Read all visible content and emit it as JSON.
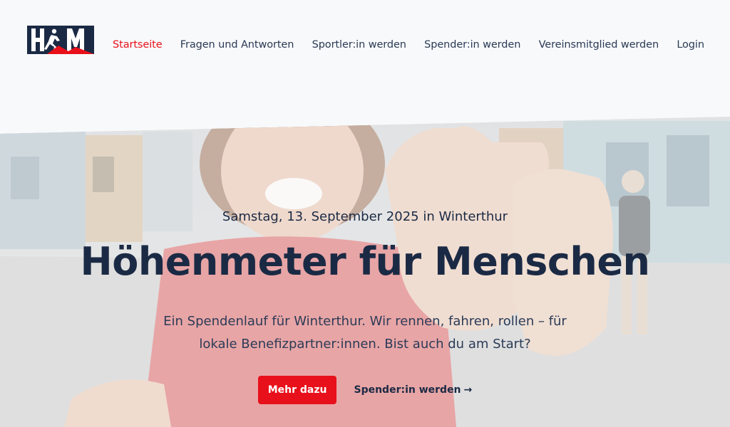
{
  "brand": {
    "logo_text": "HFM",
    "colors": {
      "navy": "#1b2a44",
      "red": "#e8101a"
    }
  },
  "nav": {
    "items": [
      {
        "label": "Startseite",
        "active": true
      },
      {
        "label": "Fragen und Antworten"
      },
      {
        "label": "Sportler:in werden"
      },
      {
        "label": "Spender:in werden"
      },
      {
        "label": "Vereinsmitglied werden"
      },
      {
        "label": "Login"
      }
    ]
  },
  "hero": {
    "date": "Samstag, 13. September 2025 in Winterthur",
    "title": "Höhenmeter für Menschen",
    "lead": "Ein Spendenlauf für Winterthur. Wir rennen, fahren, rollen – für lokale Benefizpartner:innen. Bist auch du am Start?",
    "primary_button": "Mehr dazu",
    "secondary_link": "Spender:in werden",
    "secondary_icon": "arrow-right-icon",
    "image_description_icon": "hero-photo"
  }
}
